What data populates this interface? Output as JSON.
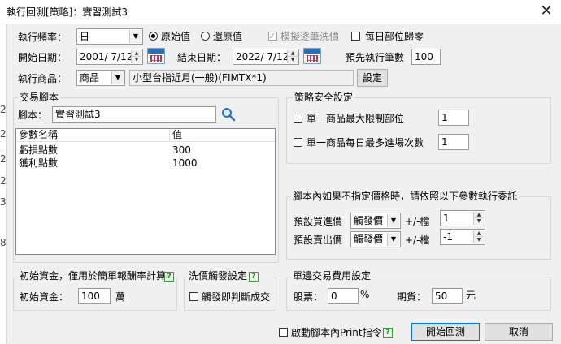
{
  "window": {
    "title": "執行回測[策略]：實習測試3",
    "close_glyph": "✕"
  },
  "left_strip_chars": [
    "2",
    "2",
    "2",
    "2",
    "3",
    "8"
  ],
  "top": {
    "freq_label": "執行頻率：",
    "freq_value": "日",
    "radio_original": "原始值",
    "radio_restore": "還原值",
    "chk_simulate": "模擬逐筆洗價",
    "chk_daily_reset": "每日部位歸零",
    "start_label": "開始日期：",
    "start_value": "2001/  7/12",
    "end_label": "結束日期：",
    "end_value": "2022/  7/12",
    "prerun_label": "預先執行筆數",
    "prerun_value": "100",
    "product_label": "執行商品：",
    "product_type": "商品",
    "product_name": "小型台指近月(一般)(FIMTX*1)",
    "settings_button": "設定"
  },
  "script_group": {
    "title": "交易腳本",
    "script_label": "腳本：",
    "script_name": "實習測試3",
    "columns": [
      "參數名稱",
      "值"
    ],
    "rows": [
      {
        "name": "虧損點數",
        "value": "300"
      },
      {
        "name": "獲利點數",
        "value": "1000"
      }
    ]
  },
  "safety_group": {
    "title": "策略安全設定",
    "max_position_label": "單一商品最大限制部位",
    "max_position_value": "1",
    "max_entries_label": "單一商品每日最多進場次數",
    "max_entries_value": "1"
  },
  "order_group": {
    "title": "腳本內如果不指定價格時，請依照以下參數執行委託",
    "buy_label": "預設買進價",
    "buy_value": "觸發價",
    "buy_ticks_label": "+/-檔",
    "buy_ticks_value": "1",
    "sell_label": "預設賣出價",
    "sell_value": "觸發價",
    "sell_ticks_label": "+/-檔",
    "sell_ticks_value": "-1"
  },
  "capital_group": {
    "title": "初始資金，僅用於簡單報酬率計算",
    "capital_label": "初始資金：",
    "capital_value": "100",
    "capital_unit": "萬"
  },
  "wash_group": {
    "title": "洗價觸發設定",
    "trigger_label": "觸發即判斷成交"
  },
  "fee_group": {
    "title": "單邊交易費用設定",
    "stock_label": "股票：",
    "stock_value": "0",
    "stock_unit": "%",
    "futures_label": "期貨：",
    "futures_value": "50",
    "futures_unit": "元"
  },
  "footer": {
    "print_label": "啟動腳本內Print指令",
    "start_button": "開始回測",
    "cancel_button": "取消"
  }
}
